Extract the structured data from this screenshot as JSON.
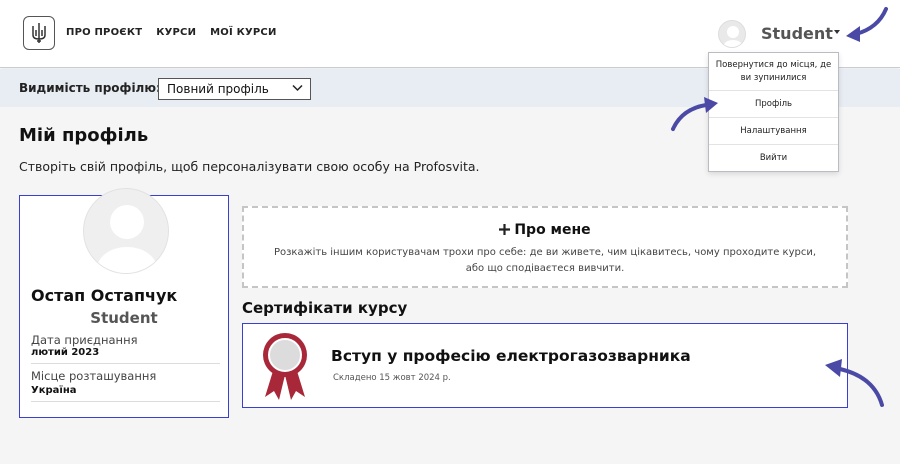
{
  "header": {
    "nav": [
      "ПРО ПРОЄКТ",
      "КУРСИ",
      "МОЇ КУРСИ"
    ],
    "username": "Student"
  },
  "user_menu": {
    "items": [
      "Повернутися до місця, де ви зупинилися",
      "Профіль",
      "Налаштування",
      "Вийти"
    ]
  },
  "visibility": {
    "label": "Видимість профілю:",
    "selected": "Повний профіль"
  },
  "page": {
    "title": "Мій профіль",
    "subtitle": "Створіть свій профіль, щоб персоналізувати свою особу на Profosvita."
  },
  "profile": {
    "name": "Остап Остапчук",
    "role": "Student",
    "joined_label": "Дата приєднання",
    "joined_value": "лютий 2023",
    "location_label": "Місце розташування",
    "location_value": "Україна"
  },
  "about": {
    "title": "Про мене",
    "text": "Розкажіть іншим користувачам трохи про себе: де ви живете, чим цікавитесь, чому проходите курси, або що сподіваєтеся вивчити."
  },
  "certificates": {
    "heading": "Сертифікати курсу",
    "items": [
      {
        "title": "Вступ у професію електрогазозварника",
        "date": "Складено 15 жовт 2024 р."
      }
    ]
  },
  "colors": {
    "accent": "#3b3fd0",
    "arrow": "#4a4aa6",
    "ribbon": "#a8283a",
    "visbar": "#e8edf3"
  },
  "icons": [
    "trident-logo-icon",
    "avatar-placeholder-icon",
    "chevron-down-icon",
    "plus-icon",
    "certificate-ribbon-icon",
    "pointer-arrow-icon"
  ]
}
